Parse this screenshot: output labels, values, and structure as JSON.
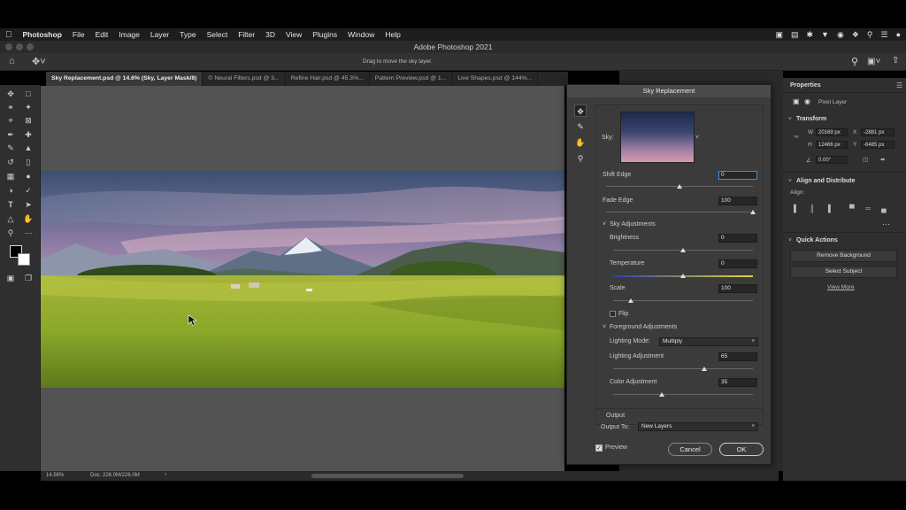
{
  "menubar": {
    "apple": "",
    "app": "Photoshop",
    "items": [
      "File",
      "Edit",
      "Image",
      "Layer",
      "Type",
      "Select",
      "Filter",
      "3D",
      "View",
      "Plugins",
      "Window",
      "Help"
    ]
  },
  "titlebar": {
    "title": "Adobe Photoshop 2021"
  },
  "options": {
    "hint": "Drag to move the sky layer."
  },
  "tabs": [
    "Sky Replacement.psd @ 14.6% (Sky, Layer Mask/8)",
    "© Neural Filters.psd @ 3...",
    "Refine Hair.psd @ 45.3%...",
    "Pattern Preview.psd @ 1...",
    "Live Shapes.psd @ 144%..."
  ],
  "status": {
    "zoom": "14.56%",
    "doc": "Doc: 226.0M/226.0M"
  },
  "dialog": {
    "title": "Sky Replacement",
    "sky_label": "Sky:",
    "shift_edge": {
      "label": "Shift Edge",
      "value": "0",
      "pos": 0.5
    },
    "fade_edge": {
      "label": "Fade Edge",
      "value": "100",
      "pos": 1.0
    },
    "sky_adjustments": "Sky Adjustments",
    "brightness": {
      "label": "Brightness",
      "value": "0",
      "pos": 0.5
    },
    "temperature": {
      "label": "Temperature",
      "value": "0",
      "pos": 0.5
    },
    "scale": {
      "label": "Scale",
      "value": "100",
      "pos": 0.18
    },
    "flip": "Flip",
    "foreground_adjustments": "Foreground Adjustments",
    "lighting_mode": {
      "label": "Lighting Mode:",
      "value": "Multiply"
    },
    "lighting_adjustment": {
      "label": "Lighting Adjustment",
      "value": "65",
      "pos": 0.65
    },
    "color_adjustment": {
      "label": "Color Adjustment",
      "value": "35",
      "pos": 0.35
    },
    "output_header": "Output",
    "output_to": {
      "label": "Output To:",
      "value": "New Layers"
    },
    "preview": "Preview",
    "cancel": "Cancel",
    "ok": "OK"
  },
  "properties": {
    "tab": "Properties",
    "layer_type": "Pixel Layer",
    "transform": "Transform",
    "w_label": "W",
    "w": "20169 px",
    "x_label": "X",
    "x": "-2881 px",
    "h_label": "H",
    "h": "12466 px",
    "y_label": "Y",
    "y": "-6485 px",
    "angle": "0.00°",
    "align": "Align and Distribute",
    "align_label": "Align:",
    "quick_actions": "Quick Actions",
    "remove_bg": "Remove Background",
    "select_subject": "Select Subject",
    "view_more": "View More"
  }
}
